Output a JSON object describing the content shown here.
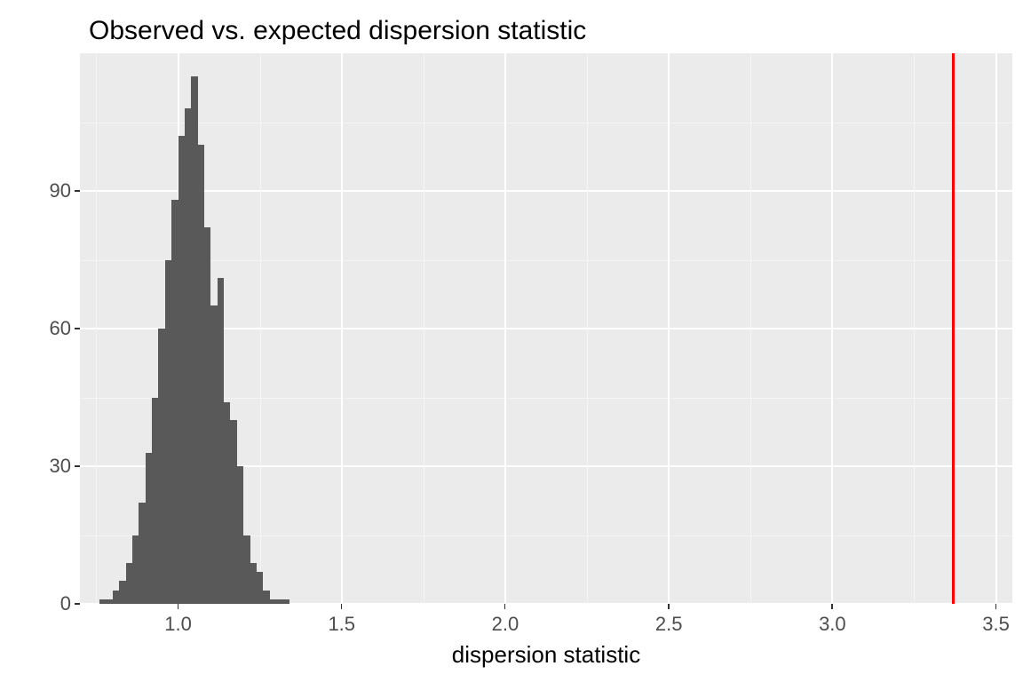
{
  "chart_data": {
    "type": "bar",
    "title": "Observed vs. expected dispersion statistic",
    "xlabel": "dispersion statistic",
    "ylabel": "",
    "xlim": [
      0.7,
      3.55
    ],
    "ylim": [
      0,
      120
    ],
    "x_ticks": [
      1.0,
      1.5,
      2.0,
      2.5,
      3.0,
      3.5
    ],
    "y_ticks": [
      0,
      30,
      60,
      90
    ],
    "bins": [
      {
        "x": 0.76,
        "count": 1
      },
      {
        "x": 0.78,
        "count": 1
      },
      {
        "x": 0.8,
        "count": 3
      },
      {
        "x": 0.82,
        "count": 5
      },
      {
        "x": 0.84,
        "count": 9
      },
      {
        "x": 0.86,
        "count": 15
      },
      {
        "x": 0.88,
        "count": 22
      },
      {
        "x": 0.9,
        "count": 33
      },
      {
        "x": 0.92,
        "count": 45
      },
      {
        "x": 0.94,
        "count": 60
      },
      {
        "x": 0.96,
        "count": 75
      },
      {
        "x": 0.98,
        "count": 88
      },
      {
        "x": 1.0,
        "count": 102
      },
      {
        "x": 1.02,
        "count": 108
      },
      {
        "x": 1.04,
        "count": 115
      },
      {
        "x": 1.06,
        "count": 100
      },
      {
        "x": 1.08,
        "count": 82
      },
      {
        "x": 1.1,
        "count": 65
      },
      {
        "x": 1.12,
        "count": 71
      },
      {
        "x": 1.14,
        "count": 44
      },
      {
        "x": 1.16,
        "count": 40
      },
      {
        "x": 1.18,
        "count": 30
      },
      {
        "x": 1.2,
        "count": 15
      },
      {
        "x": 1.22,
        "count": 9
      },
      {
        "x": 1.24,
        "count": 7
      },
      {
        "x": 1.26,
        "count": 3
      },
      {
        "x": 1.28,
        "count": 1
      },
      {
        "x": 1.3,
        "count": 1
      },
      {
        "x": 1.32,
        "count": 1
      }
    ],
    "bin_width": 0.02,
    "vline": 3.37,
    "vline_color": "#ff0000"
  }
}
